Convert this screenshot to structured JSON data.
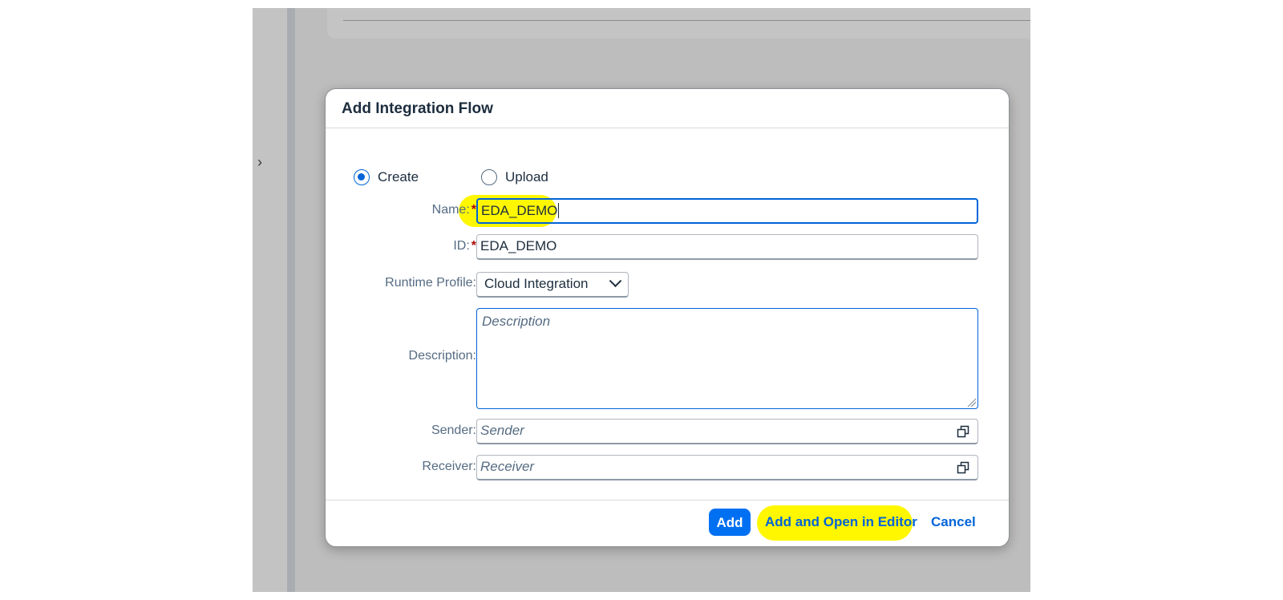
{
  "dialog": {
    "title": "Add Integration Flow",
    "mode_options": [
      {
        "label": "Create",
        "selected": true
      },
      {
        "label": "Upload",
        "selected": false
      }
    ],
    "fields": {
      "name": {
        "label": "Name:",
        "required_mark": "*",
        "value": "EDA_DEMO"
      },
      "id": {
        "label": "ID:",
        "required_mark": "*",
        "value": "EDA_DEMO"
      },
      "runtime_profile": {
        "label": "Runtime Profile:",
        "value": "Cloud Integration"
      },
      "description": {
        "label": "Description:",
        "placeholder": "Description"
      },
      "sender": {
        "label": "Sender:",
        "placeholder": "Sender"
      },
      "receiver": {
        "label": "Receiver:",
        "placeholder": "Receiver"
      }
    },
    "buttons": {
      "add": "Add",
      "add_and_open": "Add and Open in Editor",
      "cancel": "Cancel"
    }
  },
  "background": {
    "expand_icon": "chevron-right-icon"
  },
  "colors": {
    "accent": "#0064d9",
    "button_primary": "#0070f2",
    "highlight": "#fff700",
    "required": "#aa0808"
  }
}
